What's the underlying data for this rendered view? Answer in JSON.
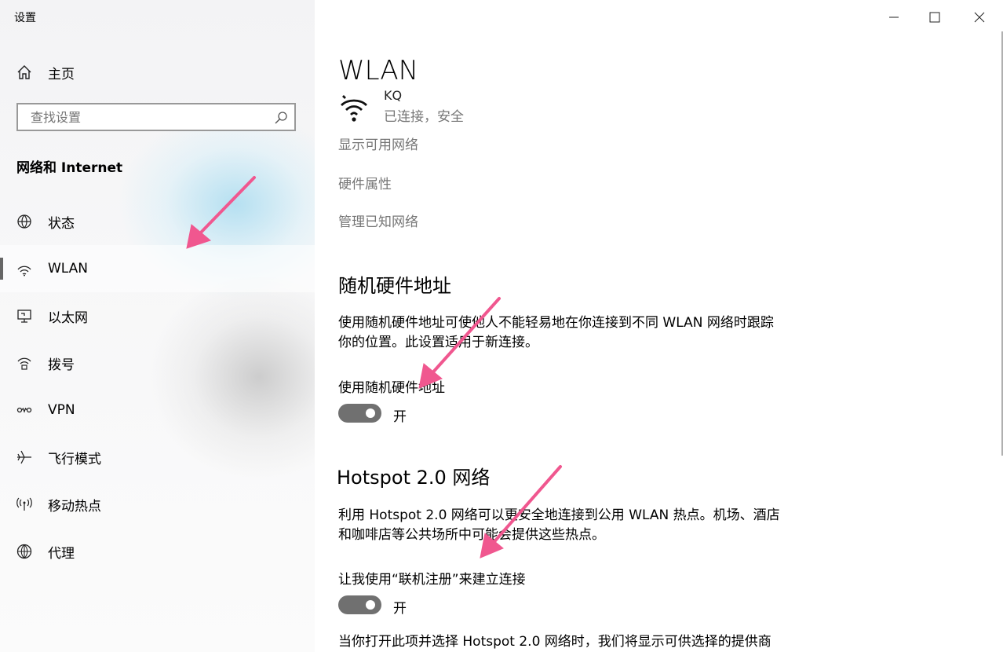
{
  "window": {
    "title": "设置"
  },
  "sidebar": {
    "home_label": "主页",
    "search_placeholder": "查找设置",
    "section_title": "网络和 Internet",
    "items": [
      {
        "label": "状态",
        "icon": "globe-status-icon"
      },
      {
        "label": "WLAN",
        "icon": "wifi-icon",
        "active": true
      },
      {
        "label": "以太网",
        "icon": "ethernet-icon"
      },
      {
        "label": "拨号",
        "icon": "dialup-icon"
      },
      {
        "label": "VPN",
        "icon": "vpn-icon"
      },
      {
        "label": "飞行模式",
        "icon": "airplane-icon"
      },
      {
        "label": "移动热点",
        "icon": "hotspot-icon"
      },
      {
        "label": "代理",
        "icon": "globe-icon"
      }
    ]
  },
  "main": {
    "title": "WLAN",
    "network": {
      "name": "KQ",
      "status": "已连接，安全"
    },
    "links": [
      "显示可用网络",
      "硬件属性",
      "管理已知网络"
    ],
    "random_hw": {
      "heading": "随机硬件地址",
      "description": "使用随机硬件地址可使他人不能轻易地在你连接到不同 WLAN 网络时跟踪你的位置。此设置适用于新连接。",
      "toggle_label": "使用随机硬件地址",
      "toggle_state": "开",
      "toggle_on": true
    },
    "hotspot": {
      "heading": "Hotspot 2.0 网络",
      "description": "利用 Hotspot 2.0 网络可以更安全地连接到公用 WLAN 热点。机场、酒店和咖啡店等公共场所中可能会提供这些热点。",
      "toggle_label": "让我使用“联机注册”来建立连接",
      "toggle_state": "开",
      "toggle_on": true,
      "footer_text": "当你打开此项并选择 Hotspot 2.0 网络时，我们将显示可供选择的提供商"
    }
  },
  "colors": {
    "annotation_arrow": "#f0578f",
    "toggle_track": "#707070",
    "secondary_text": "#767676"
  }
}
